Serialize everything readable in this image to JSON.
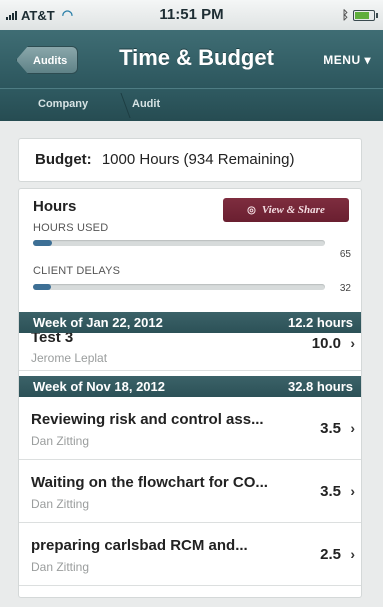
{
  "status_bar": {
    "carrier": "AT&T",
    "time": "11:51 PM"
  },
  "nav": {
    "back_label": "Audits",
    "title": "Time & Budget",
    "menu_label": "MENU ▾"
  },
  "breadcrumb": {
    "items": [
      "Company",
      "Audit"
    ]
  },
  "budget": {
    "label": "Budget:",
    "value": "1000 Hours (934 Remaining)"
  },
  "hours": {
    "title": "Hours",
    "share_label": "View & Share",
    "meters": [
      {
        "label": "HOURS USED",
        "value": "65",
        "fraction": 0.065
      },
      {
        "label": "CLIENT DELAYS",
        "value": "32",
        "fraction": 0.032
      }
    ]
  },
  "weeks": [
    {
      "label": "Week of Jan 22, 2012",
      "total": "12.2 hours",
      "entries": [
        {
          "title": "Test 3",
          "author": "Jerome Leplat",
          "hours": "10.0"
        }
      ]
    },
    {
      "label": "Week of Nov 18, 2012",
      "total": "32.8 hours",
      "entries": [
        {
          "title": "Reviewing risk and control ass...",
          "author": "Dan Zitting",
          "hours": "3.5"
        },
        {
          "title": "Waiting on the flowchart for CO...",
          "author": "Dan Zitting",
          "hours": "3.5"
        },
        {
          "title": "preparing carlsbad RCM and...",
          "author": "Dan Zitting",
          "hours": "2.5"
        }
      ]
    }
  ],
  "colors": {
    "nav_bar": "#2f5a61",
    "share_button": "#7a2a3b",
    "meter_fill": "#3d6f95"
  },
  "icons": {
    "back": "back-arrow-icon",
    "share": "share-icon",
    "row": "chevron-right-icon"
  }
}
